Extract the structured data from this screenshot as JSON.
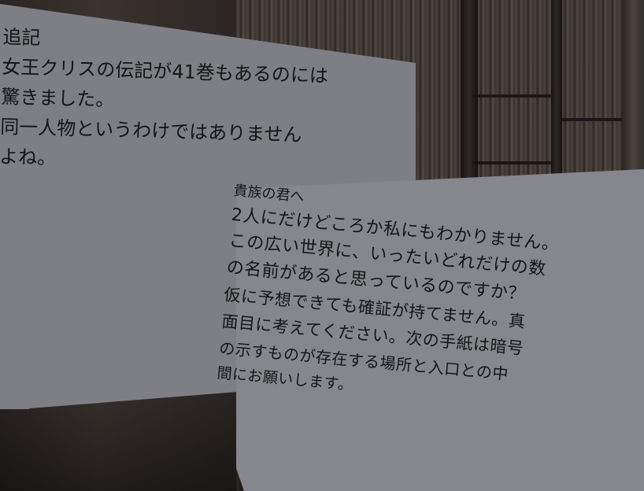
{
  "note_back": {
    "title": "追記",
    "lines": [
      "女王クリスの伝記が41巻もあるのには",
      "驚きました。",
      "同一人物というわけではありません",
      "よね。"
    ]
  },
  "note_front": {
    "salutation": "貴族の君へ",
    "lines": [
      "2人にだけどころか私にもわかりません。",
      "この広い世界に、いったいどれだけの数",
      "の名前があると思っているのですか？",
      "仮に予想できても確証が持てません。真",
      "面目に考えてください。次の手紙は暗号",
      "の示すものが存在する場所と入口との中",
      "間にお願いします。"
    ]
  }
}
